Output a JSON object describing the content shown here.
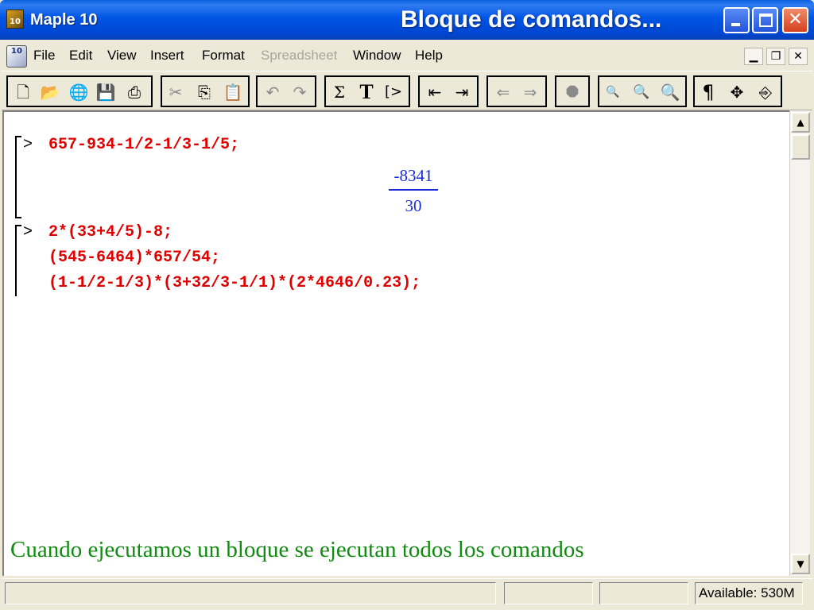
{
  "window": {
    "app_title": "Maple 10",
    "app_icon_label": "10",
    "slide_title": "Bloque de comandos...",
    "icons": [
      "app-icon",
      "minimize-icon",
      "maximize-icon",
      "close-icon"
    ]
  },
  "menu": {
    "icon_label": "10",
    "items": [
      {
        "label": "File",
        "enabled": true
      },
      {
        "label": "Edit",
        "enabled": true
      },
      {
        "label": "View",
        "enabled": true
      },
      {
        "label": "Insert",
        "enabled": true
      },
      {
        "label": "Format",
        "enabled": true
      },
      {
        "label": "Spreadsheet",
        "enabled": false
      },
      {
        "label": "Window",
        "enabled": true
      },
      {
        "label": "Help",
        "enabled": true
      }
    ],
    "mdi_controls": [
      "minimize-icon",
      "restore-icon",
      "close-icon"
    ]
  },
  "toolbar": {
    "icons": [
      "new-icon",
      "open-icon",
      "open-url-icon",
      "save-icon",
      "print-icon",
      "cut-icon",
      "copy-icon",
      "paste-icon",
      "undo-icon",
      "redo-icon",
      "math-input-icon",
      "text-input-icon",
      "execution-group-icon",
      "outdent-icon",
      "indent-icon",
      "back-icon",
      "forward-icon",
      "stop-icon",
      "zoom-100-icon",
      "zoom-150-icon",
      "zoom-200-icon",
      "paragraph-icon",
      "move-icon",
      "restart-icon"
    ],
    "glyphs": {
      "sigma": "Σ",
      "text_t": "T",
      "exec": "[>",
      "paragraph": "¶"
    }
  },
  "document": {
    "prompt_symbol": ">",
    "group1": {
      "command": "657-934-1/2-1/3-1/5;",
      "result_numerator": "-8341",
      "result_denominator": "30"
    },
    "group2": {
      "commands": [
        "2*(33+4/5)-8;",
        "(545-6464)*657/54;",
        "(1-1/2-1/3)*(3+32/3-1/1)*(2*4646/0.23);"
      ]
    },
    "caption": "Cuando ejecutamos un bloque se ejecutan todos  los comandos"
  },
  "status": {
    "available": "Available: 530M"
  },
  "colors": {
    "titlebar": "#0055e5",
    "command_red": "#e00000",
    "output_blue": "#1a2bd6",
    "caption_green": "#108a10",
    "chrome": "#ece9d8"
  }
}
